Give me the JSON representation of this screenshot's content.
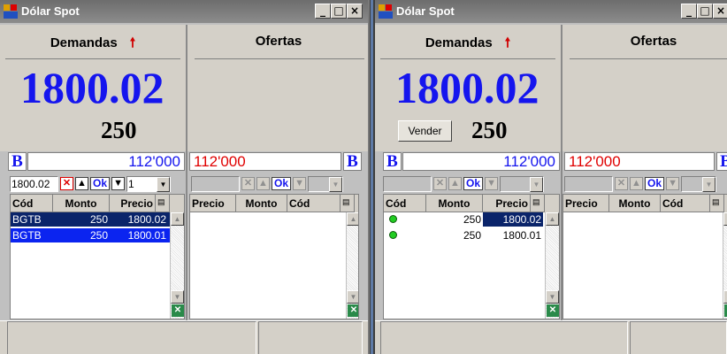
{
  "windows": [
    {
      "title": "Dólar Spot",
      "demandas_label": "Demandas",
      "ofertas_label": "Ofertas",
      "price": "1800.02",
      "quantity": "250",
      "bid_volume": "112'000",
      "ask_volume": "112'000",
      "side_marker": "B",
      "entry_price": "1800.02",
      "entry_qty": "1",
      "ok_label": "Ok",
      "bid_columns": [
        "Cód",
        "Monto",
        "Precio"
      ],
      "ask_columns": [
        "Precio",
        "Monto",
        "Cód"
      ],
      "bid_rows": [
        {
          "cod": "BGTB",
          "monto": "250",
          "precio": "1800.02"
        },
        {
          "cod": "BGTB",
          "monto": "250",
          "precio": "1800.01"
        }
      ]
    },
    {
      "title": "Dólar Spot",
      "demandas_label": "Demandas",
      "ofertas_label": "Ofertas",
      "price": "1800.02",
      "quantity": "250",
      "vender_label": "Vender",
      "bid_volume": "112'000",
      "ask_volume": "112'000",
      "side_marker": "B",
      "ok_label": "Ok",
      "bid_columns": [
        "Cód",
        "Monto",
        "Precio"
      ],
      "ask_columns": [
        "Precio",
        "Monto",
        "Cód"
      ],
      "bid_rows": [
        {
          "monto": "250",
          "precio": "1800.02"
        },
        {
          "monto": "250",
          "precio": "1800.01"
        }
      ]
    }
  ],
  "colors": {
    "price_blue": "#1515ee",
    "ask_red": "#e00000",
    "selection": "#0a246a"
  }
}
